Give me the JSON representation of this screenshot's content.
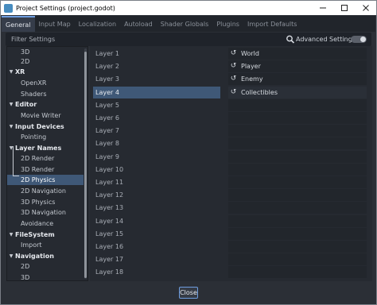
{
  "window": {
    "title": "Project Settings (project.godot)",
    "controls": [
      "minimize-icon",
      "maximize-icon",
      "close-icon"
    ]
  },
  "tabs": [
    {
      "label": "General",
      "active": true
    },
    {
      "label": "Input Map"
    },
    {
      "label": "Localization"
    },
    {
      "label": "Autoload"
    },
    {
      "label": "Shader Globals"
    },
    {
      "label": "Plugins"
    },
    {
      "label": "Import Defaults"
    }
  ],
  "filter": {
    "placeholder": "Filter Settings",
    "icon": "search-icon"
  },
  "advanced": {
    "label": "Advanced Settings",
    "enabled": false
  },
  "tree": [
    {
      "label": "3D",
      "kind": "child"
    },
    {
      "label": "2D",
      "kind": "child"
    },
    {
      "label": "XR",
      "kind": "section"
    },
    {
      "label": "OpenXR",
      "kind": "child"
    },
    {
      "label": "Shaders",
      "kind": "child"
    },
    {
      "label": "Editor",
      "kind": "section"
    },
    {
      "label": "Movie Writer",
      "kind": "child"
    },
    {
      "label": "Input Devices",
      "kind": "section"
    },
    {
      "label": "Pointing",
      "kind": "child"
    },
    {
      "label": "Layer Names",
      "kind": "section"
    },
    {
      "label": "2D Render",
      "kind": "child"
    },
    {
      "label": "3D Render",
      "kind": "child"
    },
    {
      "label": "2D Physics",
      "kind": "child",
      "selected": true
    },
    {
      "label": "2D Navigation",
      "kind": "child"
    },
    {
      "label": "3D Physics",
      "kind": "child"
    },
    {
      "label": "3D Navigation",
      "kind": "child"
    },
    {
      "label": "Avoidance",
      "kind": "child"
    },
    {
      "label": "FileSystem",
      "kind": "section"
    },
    {
      "label": "Import",
      "kind": "child"
    },
    {
      "label": "Navigation",
      "kind": "section"
    },
    {
      "label": "2D",
      "kind": "child"
    },
    {
      "label": "3D",
      "kind": "child"
    }
  ],
  "layers": [
    {
      "label": "Layer 1",
      "value": "World",
      "revert": true
    },
    {
      "label": "Layer 2",
      "value": "Player",
      "revert": true
    },
    {
      "label": "Layer 3",
      "value": "Enemy",
      "revert": true
    },
    {
      "label": "Layer 4",
      "value": "Collectibles",
      "revert": true,
      "active": true
    },
    {
      "label": "Layer 5",
      "value": ""
    },
    {
      "label": "Layer 6",
      "value": ""
    },
    {
      "label": "Layer 7",
      "value": ""
    },
    {
      "label": "Layer 8",
      "value": ""
    },
    {
      "label": "Layer 9",
      "value": ""
    },
    {
      "label": "Layer 10",
      "value": ""
    },
    {
      "label": "Layer 11",
      "value": ""
    },
    {
      "label": "Layer 12",
      "value": ""
    },
    {
      "label": "Layer 13",
      "value": ""
    },
    {
      "label": "Layer 14",
      "value": ""
    },
    {
      "label": "Layer 15",
      "value": ""
    },
    {
      "label": "Layer 16",
      "value": ""
    },
    {
      "label": "Layer 17",
      "value": ""
    },
    {
      "label": "Layer 18",
      "value": ""
    }
  ],
  "footer": {
    "close_label": "Close"
  },
  "colors": {
    "accent": "#6f9ee0",
    "selection": "#3f5877",
    "background": "#2b2f36"
  }
}
